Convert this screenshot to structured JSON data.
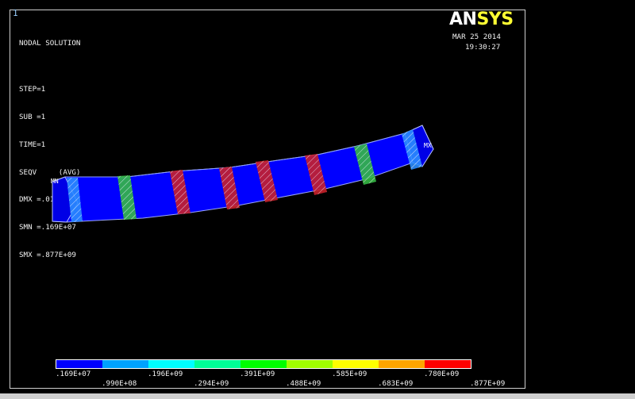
{
  "window_number": "1",
  "info_lines": [
    "NODAL SOLUTION",
    "",
    "STEP=1",
    "SUB =1",
    "TIME=1",
    "SEQV     (AVG)",
    "DMX =.018641",
    "SMN =.169E+07",
    "SMX =.877E+09"
  ],
  "brand": {
    "prefix": "AN",
    "suffix": "SYS"
  },
  "date": "MAR 25 2014",
  "time": "19:30:27",
  "markers": {
    "min": "MN",
    "max": "MX"
  },
  "legend": {
    "colors": [
      "#0000ff",
      "#00a2ff",
      "#00ffff",
      "#00ff96",
      "#00ff00",
      "#a0ff00",
      "#ffff00",
      "#ffa500",
      "#ff0000"
    ],
    "labels_top": [
      ".169E+07",
      ".196E+09",
      ".391E+09",
      ".585E+09",
      ".780E+09"
    ],
    "labels_bottom": [
      ".990E+08",
      ".294E+09",
      ".488E+09",
      ".683E+09",
      ".877E+09"
    ]
  },
  "colors": {
    "background": "#000000",
    "beam_base": "#0000ff",
    "beam_dark": "#0010c8",
    "frame": "#cfcfcf"
  }
}
